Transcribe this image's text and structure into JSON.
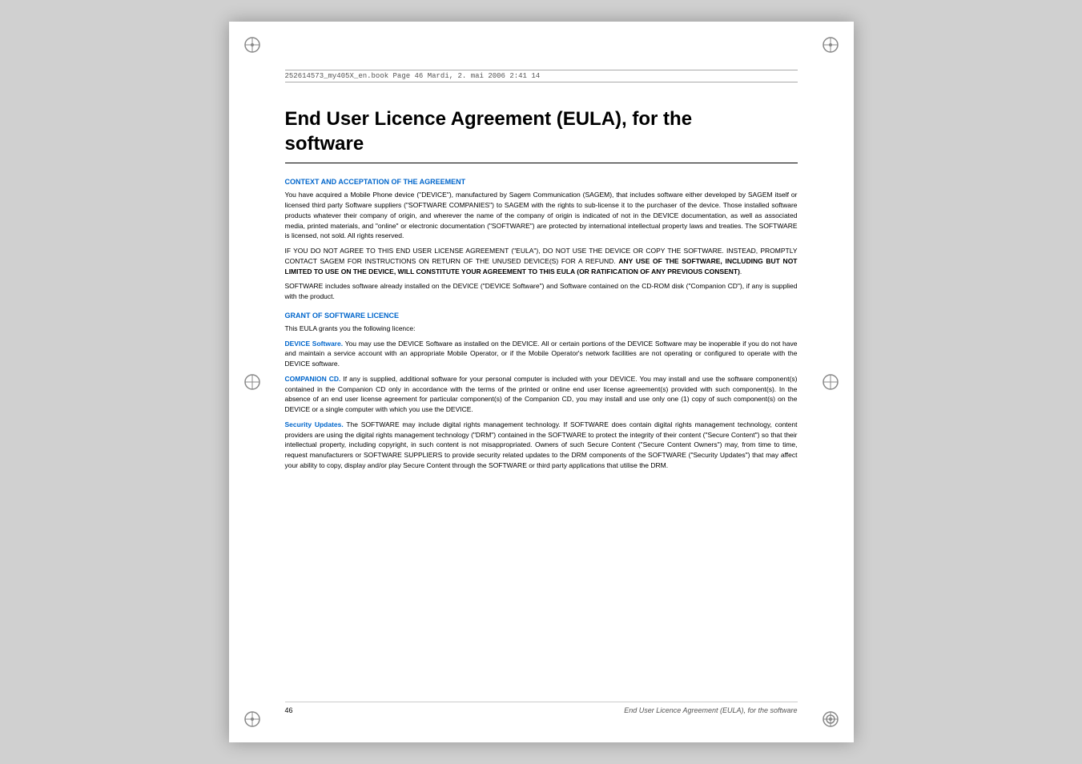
{
  "page": {
    "file_info": "252614573_my405X_en.book  Page 46  Mardi, 2. mai 2006  2:41 14",
    "title_line1": "End User Licence Agreement (EULA), for the",
    "title_line2": "software",
    "sections": [
      {
        "id": "context",
        "heading": "CONTEXT AND ACCEPTATION OF THE AGREEMENT",
        "paragraphs": [
          "You have acquired a Mobile Phone device (\"DEVICE\"), manufactured by Sagem Communication (SAGEM), that includes software either developed by SAGEM itself or licensed third party Software suppliers (\"SOFTWARE COMPANIES\") to SAGEM with the rights to sub-license it to the purchaser of the device. Those installed software products whatever their company of origin, and wherever the name of the company of origin is indicated of not in the DEVICE documentation, as well as associated media, printed materials, and \"online\" or electronic documentation (\"SOFTWARE\") are protected by international intellectual property laws and treaties. The SOFTWARE is licensed, not sold.  All rights reserved.",
          "IF YOU DO NOT AGREE TO THIS END USER LICENSE AGREEMENT (\"EULA\"), DO NOT USE THE DEVICE OR COPY THE SOFTWARE. INSTEAD, PROMPTLY CONTACT SAGEM FOR INSTRUCTIONS ON RETURN OF THE UNUSED DEVICE(S) FOR A REFUND. __ANY USE OF THE SOFTWARE, INCLUDING BUT NOT LIMITED TO USE ON THE DEVICE, WILL CONSTITUTE YOUR AGREEMENT TO THIS EULA (OR RATIFICATION OF ANY PREVIOUS CONSENT).__",
          "SOFTWARE includes software already installed on the DEVICE (\"DEVICE Software\") and Software contained on the CD-ROM disk (\"Companion CD\"), if any is supplied with the product."
        ]
      },
      {
        "id": "grant",
        "heading": "GRANT OF SOFTWARE LICENCE",
        "intro": "This EULA grants you the following licence:",
        "subsections": [
          {
            "id": "device-software",
            "label": "DEVICE Software.",
            "text": " You may use the DEVICE Software as installed on the DEVICE.  All or certain portions of the DEVICE Software may be inoperable if you do not have and maintain a service account with an appropriate Mobile Operator, or if the Mobile Operator's network facilities are not operating or configured to operate with the DEVICE software."
          },
          {
            "id": "companion-cd",
            "label": "COMPANION CD.",
            "text": " If any is supplied, additional software for your personal computer is included with your DEVICE. You may install and use the software component(s) contained in the Companion CD only in accordance with the terms of the printed or online end user license agreement(s) provided with such component(s).  In the absence of an end user license agreement for particular component(s) of the Companion CD, you may install and use only one (1) copy of such component(s) on the DEVICE or a single computer with which you use the DEVICE."
          },
          {
            "id": "security-updates",
            "label": "Security Updates.",
            "text": " The SOFTWARE may include digital rights management technology.  If SOFTWARE does contain digital rights management technology, content providers are using the digital rights management technology (\"DRM\") contained in the SOFTWARE to protect the integrity of their content (\"Secure Content\") so that their intellectual property, including copyright, in such content is not misappropriated.  Owners of such Secure Content (\"Secure Content Owners\") may, from time to time, request manufacturers or SOFTWARE SUPPLIERS to provide security related updates to the DRM components of the SOFTWARE (\"Security Updates\") that may affect your ability to copy, display and/or play Secure Content through the SOFTWARE or third party applications that utilise the DRM."
          }
        ]
      }
    ],
    "footer": {
      "page_number": "46",
      "title": "End User Licence Agreement (EULA), for the software"
    }
  }
}
